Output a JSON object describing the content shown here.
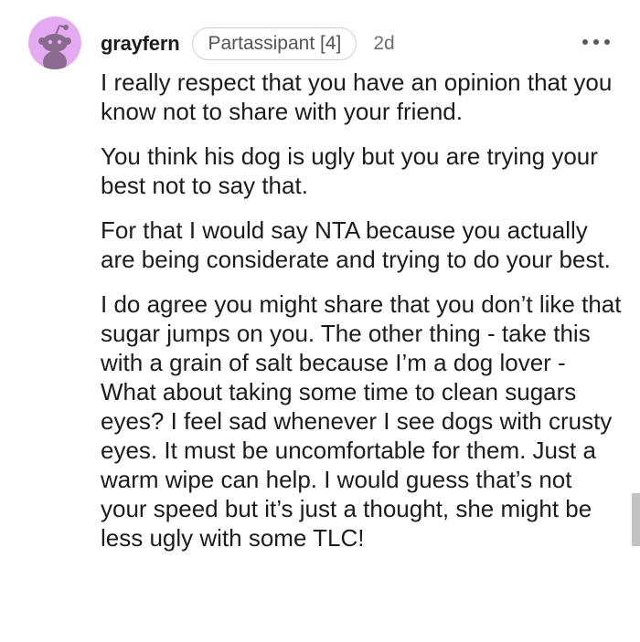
{
  "comment": {
    "username": "grayfern",
    "flair": "Partassipant [4]",
    "timestamp": "2d",
    "avatar_icon": "reddit-snoo-avatar-icon",
    "more_icon": "more-options-icon",
    "paragraphs": [
      "I really respect that you have an opinion that you know not to share with your friend.",
      "You think his dog is ugly but you are trying your best not to say that.",
      "For that I would say NTA because you actually are being considerate and trying to do your best.",
      "I do agree you might share that you don’t like that sugar jumps on you. The other thing - take this with a grain of salt because I’m a dog lover - What about taking some time to clean sugars eyes? I feel sad whenever I see dogs with crusty eyes. It must be uncomfortable for them. Just a warm wipe can help. I would guess that’s not your speed but it’s just a thought, she might be less ugly with some TLC!"
    ]
  },
  "colors": {
    "avatar_background": "#e4aaf2",
    "avatar_figure": "#8b6a8f",
    "flair_border": "#cfcfcf",
    "text": "#1c1c1c",
    "meta_text": "#6e6e6e"
  }
}
